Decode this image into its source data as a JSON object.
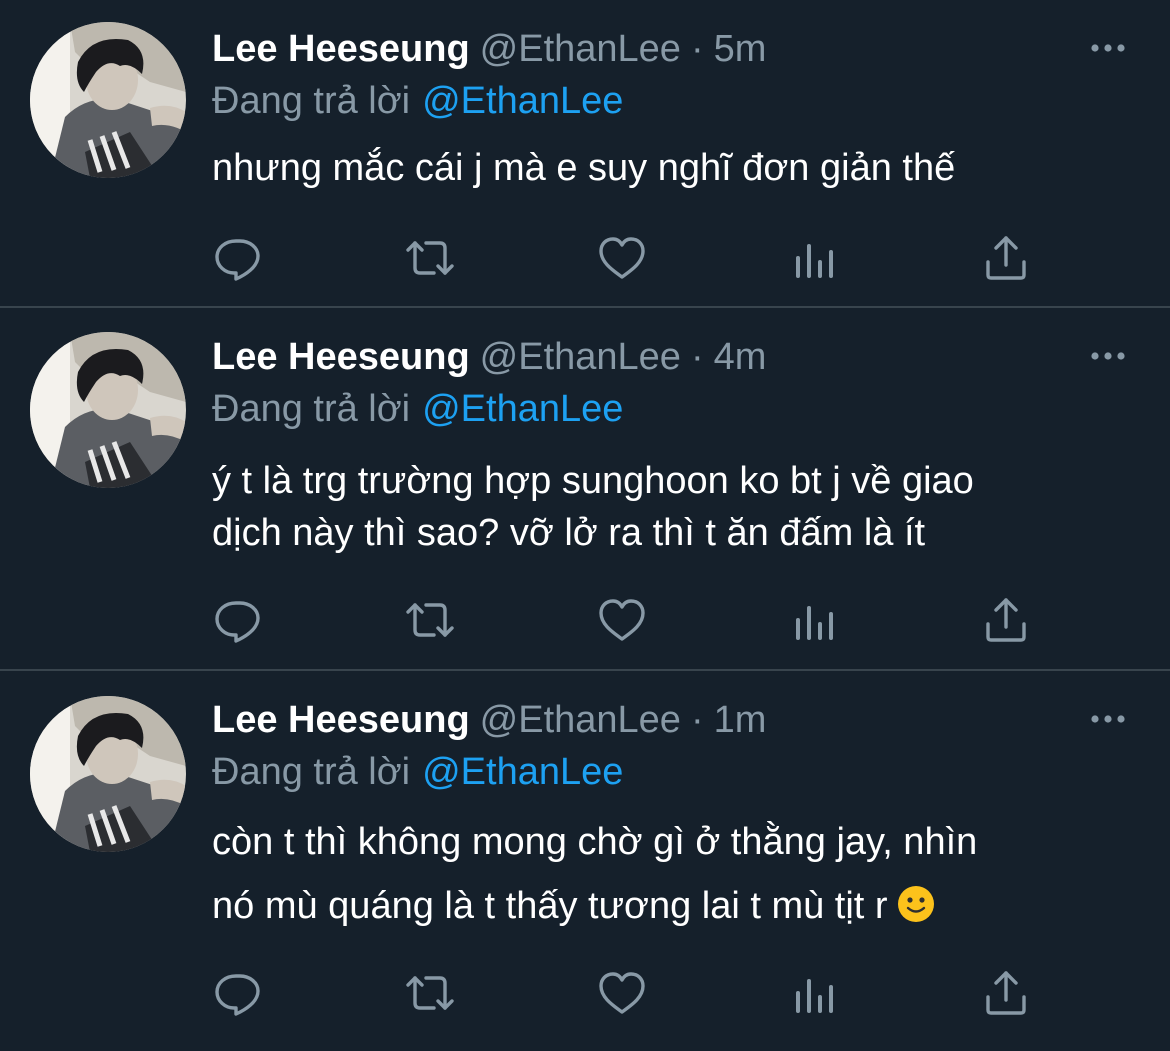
{
  "colors": {
    "background": "#15202b",
    "divider": "#38444d",
    "text_primary": "#ffffff",
    "text_secondary": "#8899a6",
    "link": "#1da1f2"
  },
  "tweets": [
    {
      "name": "Lee Heeseung",
      "handle": "@EthanLee",
      "dot": "·",
      "time": "5m",
      "replying_label": "Đang trả lời",
      "replying_to": "@EthanLee",
      "lines": [
        "nhưng mắc cái j mà e suy nghĩ đơn giản thế"
      ],
      "icons": [
        "avatar",
        "more-icon",
        "reply-icon",
        "retweet-icon",
        "like-icon",
        "analytics-icon",
        "share-icon"
      ]
    },
    {
      "name": "Lee Heeseung",
      "handle": "@EthanLee",
      "dot": "·",
      "time": "4m",
      "replying_label": "Đang trả lời",
      "replying_to": "@EthanLee",
      "lines": [
        "ý t là trg trường hợp sunghoon ko bt j về giao",
        "dịch này thì sao? vỡ lở ra thì t ăn đấm là ít"
      ],
      "icons": [
        "avatar",
        "more-icon",
        "reply-icon",
        "retweet-icon",
        "like-icon",
        "analytics-icon",
        "share-icon"
      ]
    },
    {
      "name": "Lee Heeseung",
      "handle": "@EthanLee",
      "dot": "·",
      "time": "1m",
      "replying_label": "Đang trả lời",
      "replying_to": "@EthanLee",
      "lines": [
        "còn t thì không mong chờ gì ở thằng jay, nhìn",
        "nó mù quáng là t thấy tương lai t mù tịt r"
      ],
      "emoji": "slightly-smiling-face-emoji",
      "icons": [
        "avatar",
        "more-icon",
        "reply-icon",
        "retweet-icon",
        "like-icon",
        "analytics-icon",
        "share-icon",
        "slightly-smiling-face-emoji"
      ]
    }
  ]
}
